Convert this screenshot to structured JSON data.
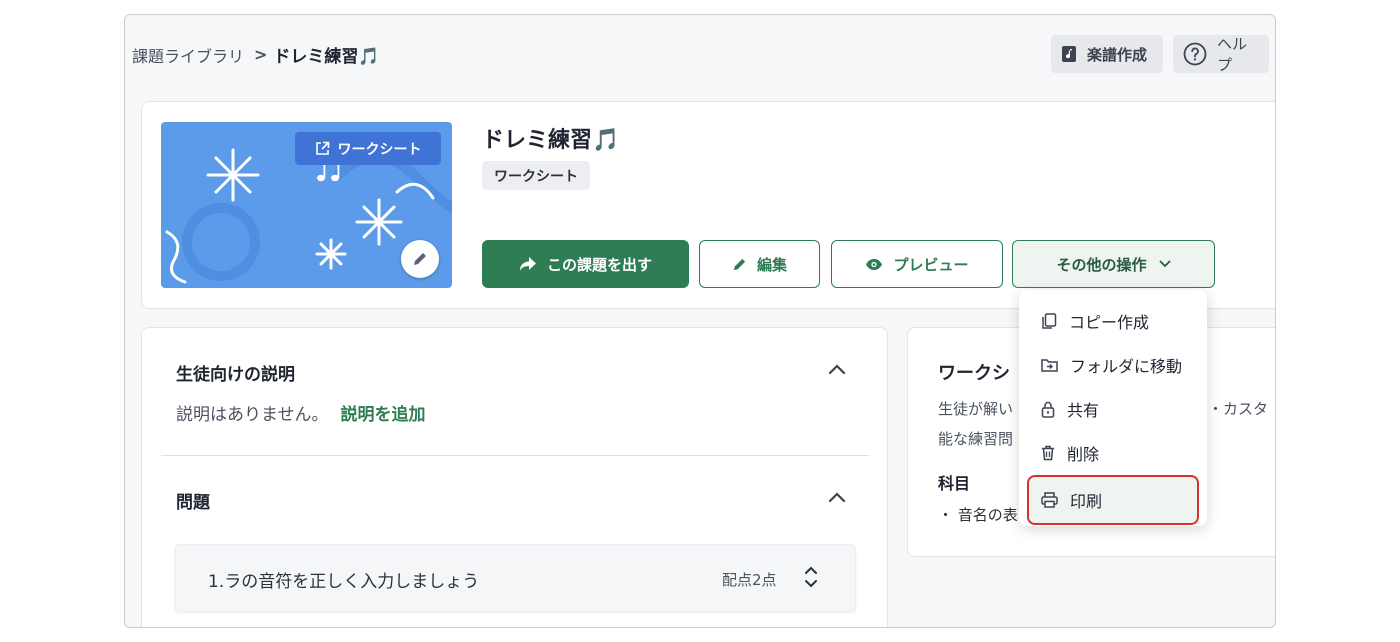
{
  "breadcrumb": {
    "parent": "課題ライブラリ",
    "separator": ">",
    "current": "ドレミ練習🎵"
  },
  "header": {
    "score_label": "楽譜作成",
    "help_label": "ヘルプ"
  },
  "assignment": {
    "thumb_badge": "ワークシート",
    "title": "ドレミ練習🎵",
    "type": "ワークシート",
    "assign_label": "この課題を出す",
    "edit_label": "編集",
    "preview_label": "プレビュー",
    "more_label": "その他の操作"
  },
  "menu": {
    "items": [
      {
        "label": "コピー作成",
        "icon": "copy-icon"
      },
      {
        "label": "フォルダに移動",
        "icon": "folder-move-icon"
      },
      {
        "label": "共有",
        "icon": "lock-icon"
      },
      {
        "label": "削除",
        "icon": "trash-icon"
      },
      {
        "label": "印刷",
        "icon": "printer-icon",
        "highlighted": true
      }
    ]
  },
  "description": {
    "title": "生徒向けの説明",
    "empty_text": "説明はありません。",
    "add_link": "説明を追加"
  },
  "questions": {
    "title": "問題",
    "items": [
      {
        "text": "1.ラの音符を正しく入力しましょう",
        "score": "配点2点"
      }
    ]
  },
  "worksheet_info": {
    "title": "ワークシ",
    "line1_left": "生徒が解い",
    "line1_right": "・カスタ",
    "line2": "能な練習問",
    "subject_label": "科目",
    "subject_item": "・ 音名の表"
  },
  "colors": {
    "primary": "#2f7d55",
    "thumb_bg": "#5b9be9",
    "badge_bg": "#3f74d6",
    "highlight": "#d9312e"
  }
}
